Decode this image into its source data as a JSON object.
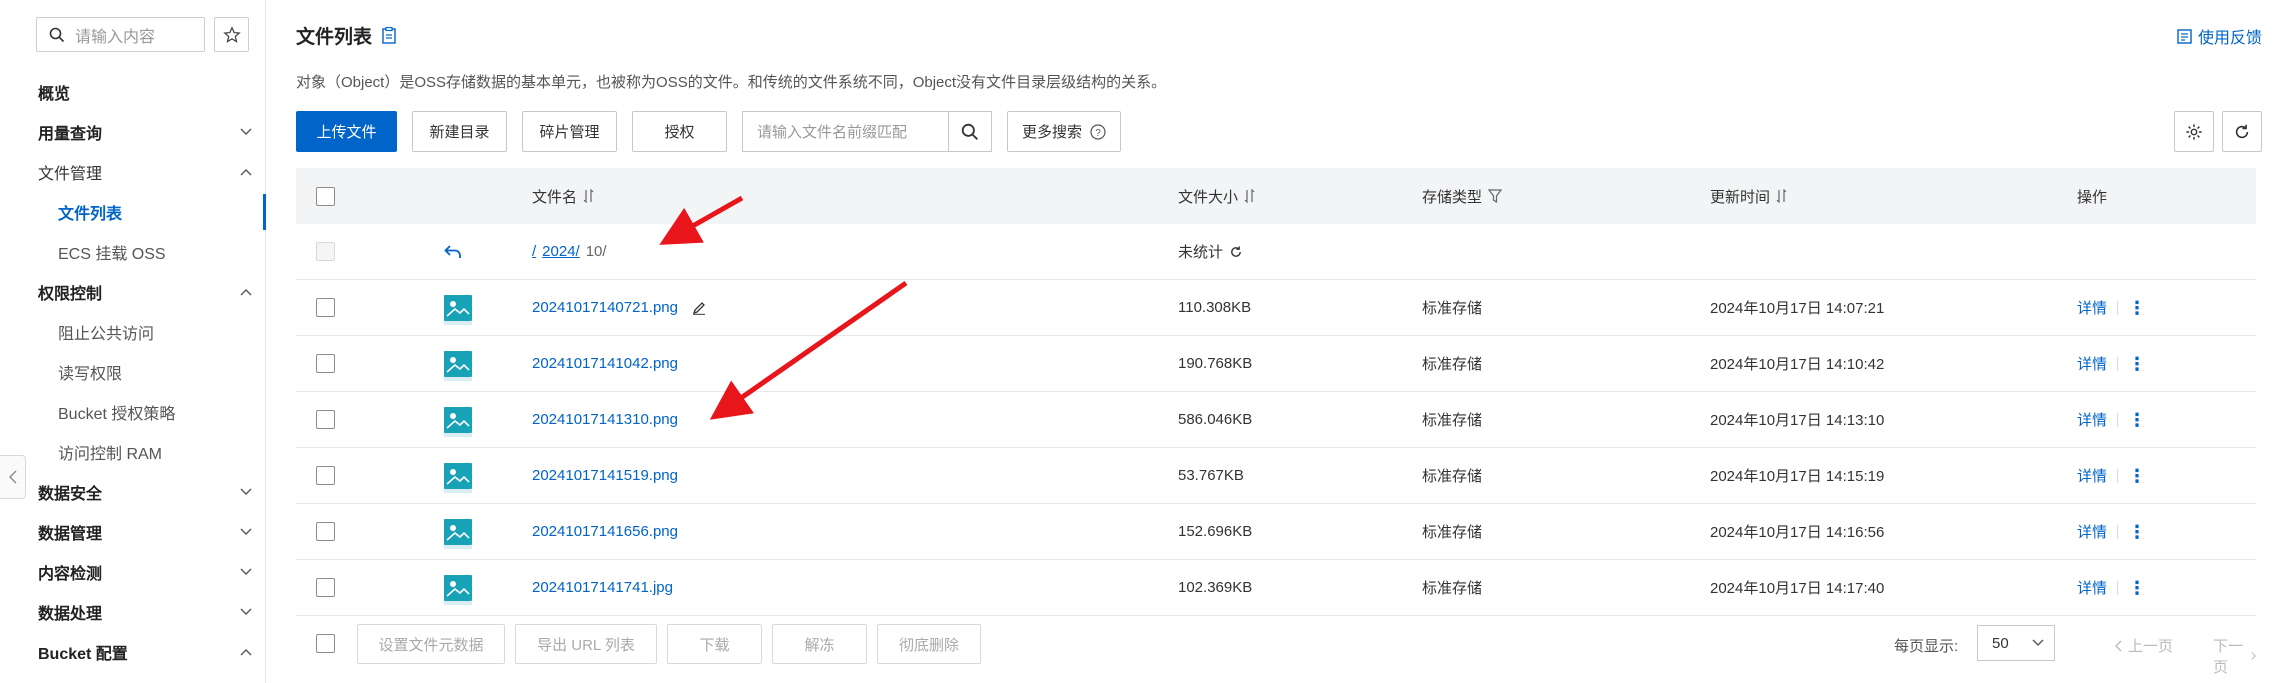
{
  "sidebar": {
    "search_placeholder": "请输入内容",
    "items": [
      {
        "label": "概览"
      },
      {
        "label": "用量查询"
      },
      {
        "label": "文件管理"
      },
      {
        "label": "文件列表"
      },
      {
        "label": "ECS 挂载 OSS"
      },
      {
        "label": "权限控制"
      },
      {
        "label": "阻止公共访问"
      },
      {
        "label": "读写权限"
      },
      {
        "label": "Bucket 授权策略"
      },
      {
        "label": "访问控制 RAM"
      },
      {
        "label": "数据安全"
      },
      {
        "label": "数据管理"
      },
      {
        "label": "内容检测"
      },
      {
        "label": "数据处理"
      },
      {
        "label": "Bucket 配置"
      }
    ]
  },
  "header": {
    "title": "文件列表",
    "feedback": "使用反馈",
    "description": "对象（Object）是OSS存储数据的基本单元，也被称为OSS的文件。和传统的文件系统不同，Object没有文件目录层级结构的关系。"
  },
  "toolbar": {
    "upload": "上传文件",
    "new_dir": "新建目录",
    "fragments": "碎片管理",
    "authorize": "授权",
    "search_placeholder": "请输入文件名前缀匹配",
    "more_search": "更多搜索"
  },
  "table": {
    "columns": {
      "name": "文件名",
      "size": "文件大小",
      "storage": "存储类型",
      "updated": "更新时间",
      "ops": "操作"
    },
    "path": {
      "sep1": "/",
      "part1": "2024/",
      "part2": "10/",
      "size": "未统计"
    },
    "rows": [
      {
        "name": "20241017140721.png",
        "size": "110.308KB",
        "storage": "标准存储",
        "updated": "2024年10月17日 14:07:21",
        "detail": "详情"
      },
      {
        "name": "20241017141042.png",
        "size": "190.768KB",
        "storage": "标准存储",
        "updated": "2024年10月17日 14:10:42",
        "detail": "详情"
      },
      {
        "name": "20241017141310.png",
        "size": "586.046KB",
        "storage": "标准存储",
        "updated": "2024年10月17日 14:13:10",
        "detail": "详情"
      },
      {
        "name": "20241017141519.png",
        "size": "53.767KB",
        "storage": "标准存储",
        "updated": "2024年10月17日 14:15:19",
        "detail": "详情"
      },
      {
        "name": "20241017141656.png",
        "size": "152.696KB",
        "storage": "标准存储",
        "updated": "2024年10月17日 14:16:56",
        "detail": "详情"
      },
      {
        "name": "20241017141741.jpg",
        "size": "102.369KB",
        "storage": "标准存储",
        "updated": "2024年10月17日 14:17:40",
        "detail": "详情"
      }
    ]
  },
  "footer": {
    "set_meta": "设置文件元数据",
    "export_urls": "导出 URL 列表",
    "download": "下载",
    "unfreeze": "解冻",
    "delete": "彻底删除",
    "per_page_label": "每页显示:",
    "per_page_value": "50",
    "prev": "上一页",
    "next": "下一页"
  },
  "colors": {
    "accent": "#0064c8",
    "thumb": "#17a2b8",
    "arrow": "#e8151b"
  }
}
